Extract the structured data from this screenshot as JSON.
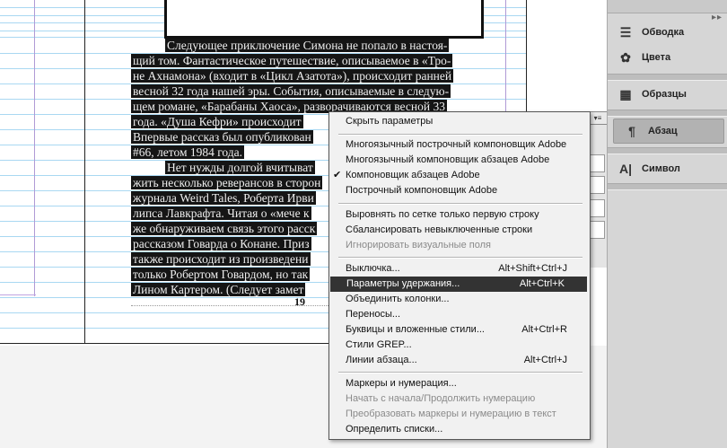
{
  "document": {
    "text_lines": [
      "Следующее приключение Симона не попало в настоя-",
      "щий том. Фантастическое путешествие, описываемое в «Тро-",
      "не Ахнамона» (входит в «Цикл Азатота»), происходит ранней",
      "весной 32 года нашей эры. События, описываемые в следую-",
      "щем романе, «Барабаны Хаоса», разворачиваются весной 33",
      "года. «Душа Кефри» происходит",
      "Впервые рассказ был опубликован",
      "#66, летом 1984 года.",
      "Нет нужды долгой вчитыват",
      "жить несколько реверансов в сторон",
      "журнала Weird Tales, Роберта Ирви",
      "липса Лавкрафта. Читая о «мече к",
      "же обнаруживаем связь этого расск",
      "рассказом Говарда о Конане. Приз",
      "также происходит из произведени",
      "только Робертом Говардом, но так",
      "Лином Картером. (Следует замет"
    ],
    "page_number": "19"
  },
  "panel": {
    "tabs": [
      {
        "label": "Обводка",
        "icon": "stroke-icon"
      },
      {
        "label": "Цвета",
        "icon": "palette-icon"
      },
      {
        "label": "Образцы",
        "icon": "swatches-icon"
      },
      {
        "label": "Абзац",
        "icon": "pilcrow-icon"
      },
      {
        "label": "Символ",
        "icon": "character-icon"
      }
    ]
  },
  "menu": {
    "items": [
      {
        "label": "Скрыть параметры",
        "shortcut": "",
        "checked": false,
        "disabled": false
      },
      {
        "label": "Многоязычный построчный компоновщик Adobe",
        "shortcut": "",
        "checked": false,
        "disabled": false
      },
      {
        "label": "Многоязычный компоновщик абзацев Adobe",
        "shortcut": "",
        "checked": false,
        "disabled": false
      },
      {
        "label": "Компоновщик абзацев Adobe",
        "shortcut": "",
        "checked": true,
        "disabled": false
      },
      {
        "label": "Построчный компоновщик Adobe",
        "shortcut": "",
        "checked": false,
        "disabled": false
      },
      {
        "label": "Выровнять по сетке только первую строку",
        "shortcut": "",
        "checked": false,
        "disabled": false
      },
      {
        "label": "Сбалансировать невыключенные строки",
        "shortcut": "",
        "checked": false,
        "disabled": false
      },
      {
        "label": "Игнорировать визуальные поля",
        "shortcut": "",
        "checked": false,
        "disabled": true
      },
      {
        "label": "Выключка...",
        "shortcut": "Alt+Shift+Ctrl+J",
        "checked": false,
        "disabled": false
      },
      {
        "label": "Параметры удержания...",
        "shortcut": "Alt+Ctrl+K",
        "checked": false,
        "disabled": false,
        "highlighted": true
      },
      {
        "label": "Объединить колонки...",
        "shortcut": "",
        "checked": false,
        "disabled": false
      },
      {
        "label": "Переносы...",
        "shortcut": "",
        "checked": false,
        "disabled": false
      },
      {
        "label": "Буквицы и вложенные стили...",
        "shortcut": "Alt+Ctrl+R",
        "checked": false,
        "disabled": false
      },
      {
        "label": "Стили GREP...",
        "shortcut": "",
        "checked": false,
        "disabled": false
      },
      {
        "label": "Линии абзаца...",
        "shortcut": "Alt+Ctrl+J",
        "checked": false,
        "disabled": false
      },
      {
        "label": "Маркеры и нумерация...",
        "shortcut": "",
        "checked": false,
        "disabled": false
      },
      {
        "label": "Начать с начала/Продолжить нумерацию",
        "shortcut": "",
        "checked": false,
        "disabled": true
      },
      {
        "label": "Преобразовать маркеры и нумерацию в текст",
        "shortcut": "",
        "checked": false,
        "disabled": true
      },
      {
        "label": "Определить списки...",
        "shortcut": "",
        "checked": false,
        "disabled": false
      }
    ]
  }
}
